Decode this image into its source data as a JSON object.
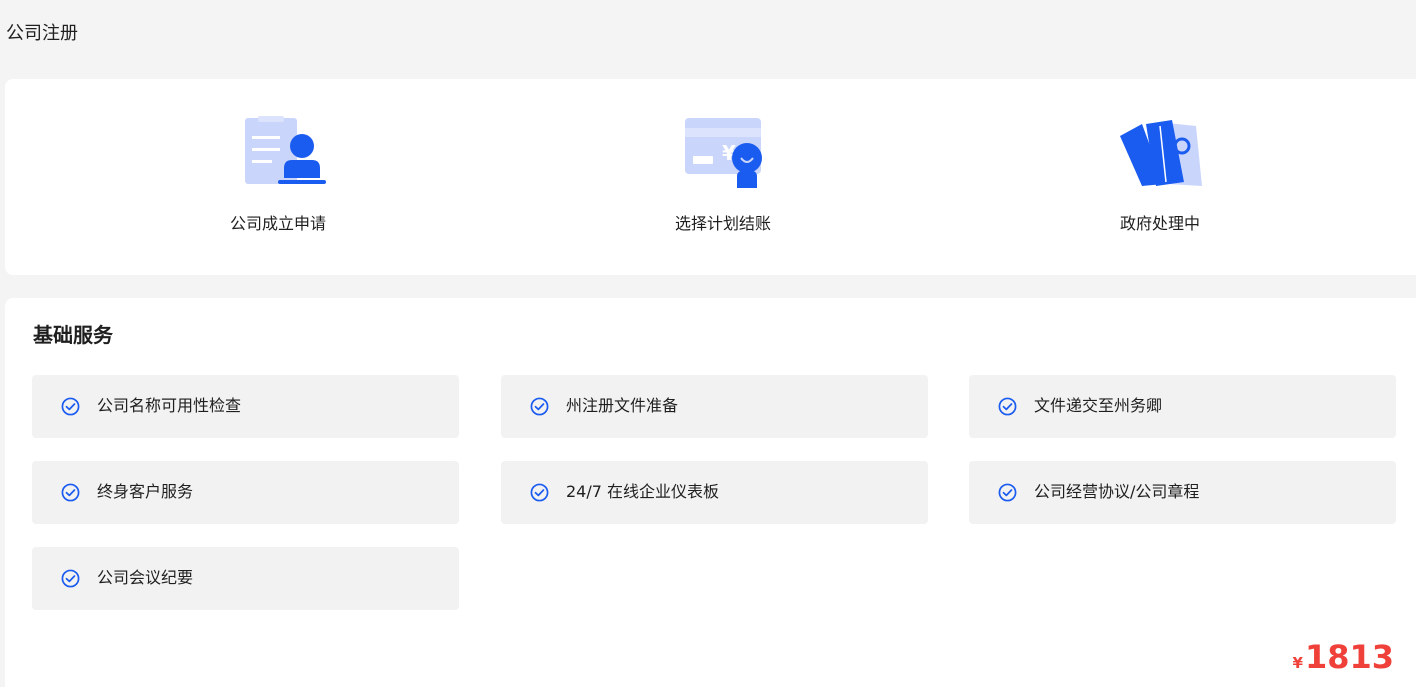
{
  "header": {
    "title": "公司注册"
  },
  "steps": [
    {
      "label": "公司成立申请",
      "icon": "application-form-icon"
    },
    {
      "label": "选择计划结账",
      "icon": "payment-checkout-icon"
    },
    {
      "label": "政府处理中",
      "icon": "government-processing-icon"
    }
  ],
  "services": {
    "title": "基础服务",
    "items": [
      {
        "label": "公司名称可用性检查"
      },
      {
        "label": "州注册文件准备"
      },
      {
        "label": "文件递交至州务卿"
      },
      {
        "label": "终身客户服务"
      },
      {
        "label": "24/7 在线企业仪表板"
      },
      {
        "label": "公司经营协议/公司章程"
      },
      {
        "label": "公司会议纪要"
      }
    ]
  },
  "price": {
    "currency": "¥",
    "amount": "1813"
  },
  "colors": {
    "accent": "#1b5cf0",
    "accent_light": "#c9d5fb",
    "price": "#f0403a",
    "item_bg": "#f2f2f2",
    "page_bg": "#f4f4f4"
  }
}
